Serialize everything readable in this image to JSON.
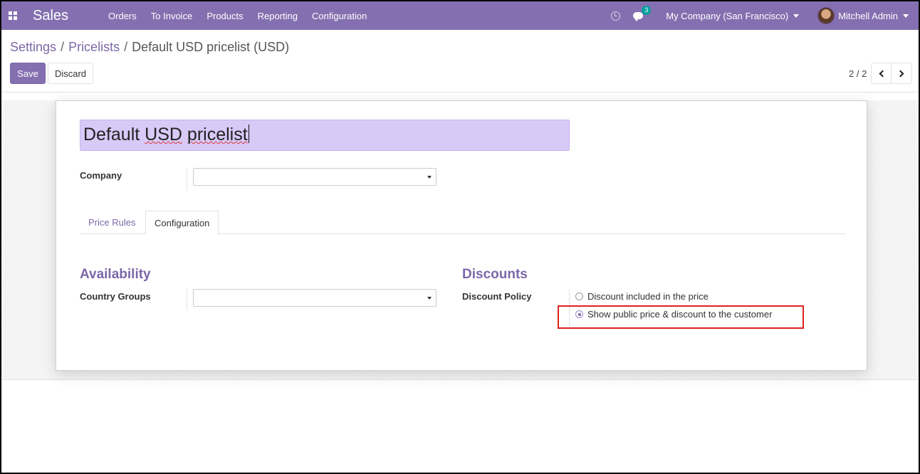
{
  "navbar": {
    "app_name": "Sales",
    "menu": [
      "Orders",
      "To Invoice",
      "Products",
      "Reporting",
      "Configuration"
    ],
    "chat_badge": "3",
    "company": "My Company (San Francisco)",
    "user": "Mitchell Admin",
    "accent_color": "#8470b0"
  },
  "breadcrumb": {
    "items": [
      "Settings",
      "Pricelists"
    ],
    "separator": "/",
    "current": "Default USD pricelist (USD)"
  },
  "actions": {
    "save_label": "Save",
    "discard_label": "Discard"
  },
  "pager": {
    "value": "2 / 2"
  },
  "form": {
    "name_word1": "Default",
    "name_space1": " ",
    "name_word2": "USD",
    "name_space2": " ",
    "name_word3": "pricelist",
    "company_label": "Company",
    "company_value": "",
    "tabs": [
      "Price Rules",
      "Configuration"
    ],
    "active_tab": "Configuration",
    "availability": {
      "title": "Availability",
      "country_groups_label": "Country Groups",
      "country_groups_value": ""
    },
    "discounts": {
      "title": "Discounts",
      "policy_label": "Discount Policy",
      "options": [
        "Discount included in the price",
        "Show public price & discount to the customer"
      ],
      "selected_option": "Show public price & discount to the customer"
    }
  },
  "annotation": {
    "highlight_color": "#dd2222"
  }
}
